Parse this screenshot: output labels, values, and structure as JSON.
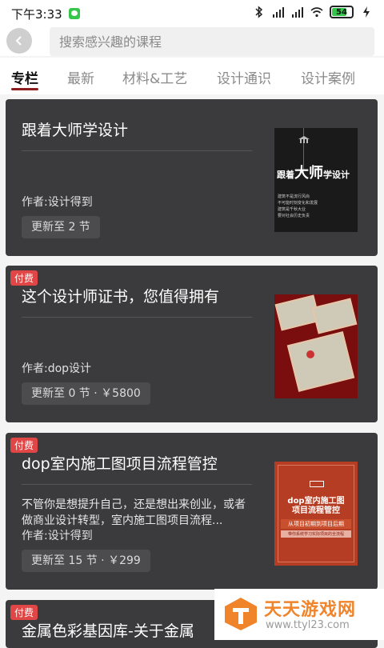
{
  "status_bar": {
    "time": "下午3:33",
    "battery": "54"
  },
  "search": {
    "placeholder": "搜索感兴趣的课程"
  },
  "tabs": [
    {
      "label": "专栏"
    },
    {
      "label": "最新"
    },
    {
      "label": "材料&工艺"
    },
    {
      "label": "设计通识"
    },
    {
      "label": "设计案例"
    }
  ],
  "cards": [
    {
      "title": "跟着大师学设计",
      "author": "作者:设计得到",
      "update": "更新至 2 节",
      "thumb": {
        "main_small": "跟着",
        "main_big": "大师",
        "main_tail": "学设计",
        "lines": [
          "建筑不是流行风尚",
          "不可能时刻变化和发展",
          "建筑是千秋大业",
          "要对社会历史负责"
        ]
      }
    },
    {
      "badge": "付费",
      "title": "这个设计师证书，您值得拥有",
      "author": "作者:dop设计",
      "update": "更新至 0 节 · ￥5800"
    },
    {
      "badge": "付费",
      "title": "dop室内施工图项目流程管控",
      "description": "不管你是想提升自己，还是想出来创业，或者做商业设计转型，室内施工图项目流程...",
      "author": "作者:设计得到",
      "update": "更新至 15 节 · ￥299",
      "thumb": {
        "title_line1": "dop室内施工图",
        "title_line2": "项目流程管控",
        "subtitle": "从项目初期到项目后期",
        "tagline": "带你系统学习实际项目的全流程"
      }
    },
    {
      "badge": "付费",
      "title": "金属色彩基因库-关于金属"
    }
  ],
  "watermark": {
    "name": "天天游戏网",
    "url": "www.ttyl23.com"
  }
}
